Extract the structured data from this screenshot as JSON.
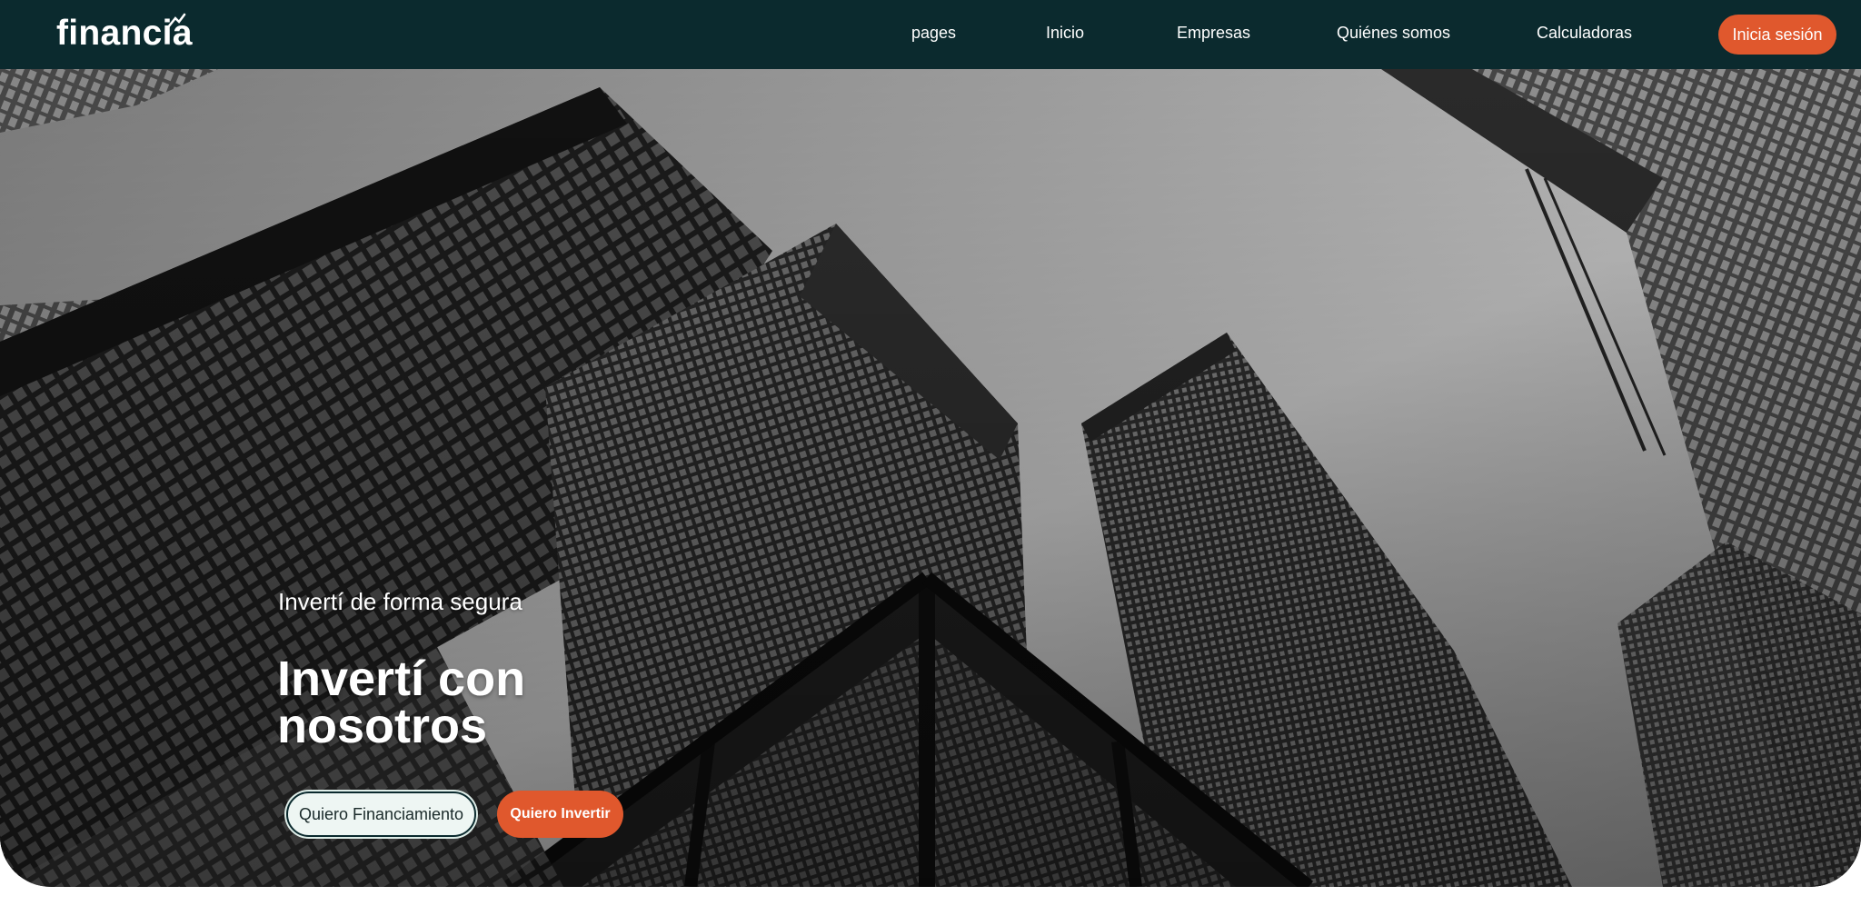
{
  "brand": {
    "name": "financia"
  },
  "nav": {
    "items": [
      {
        "label": "pages"
      },
      {
        "label": "Inicio"
      },
      {
        "label": "Empresas"
      },
      {
        "label": "Quiénes somos"
      },
      {
        "label": "Calculadoras"
      }
    ],
    "login_label": "Inicia sesión"
  },
  "hero": {
    "subtitle": "Invertí de forma segura",
    "title": "Invertí con nosotros",
    "primary_cta": "Quiero Financiamiento",
    "secondary_cta": "Quiero Invertir"
  },
  "colors": {
    "nav_background": "#0b2a2e",
    "accent": "#e0582d",
    "light_button": "#eef6f3"
  }
}
